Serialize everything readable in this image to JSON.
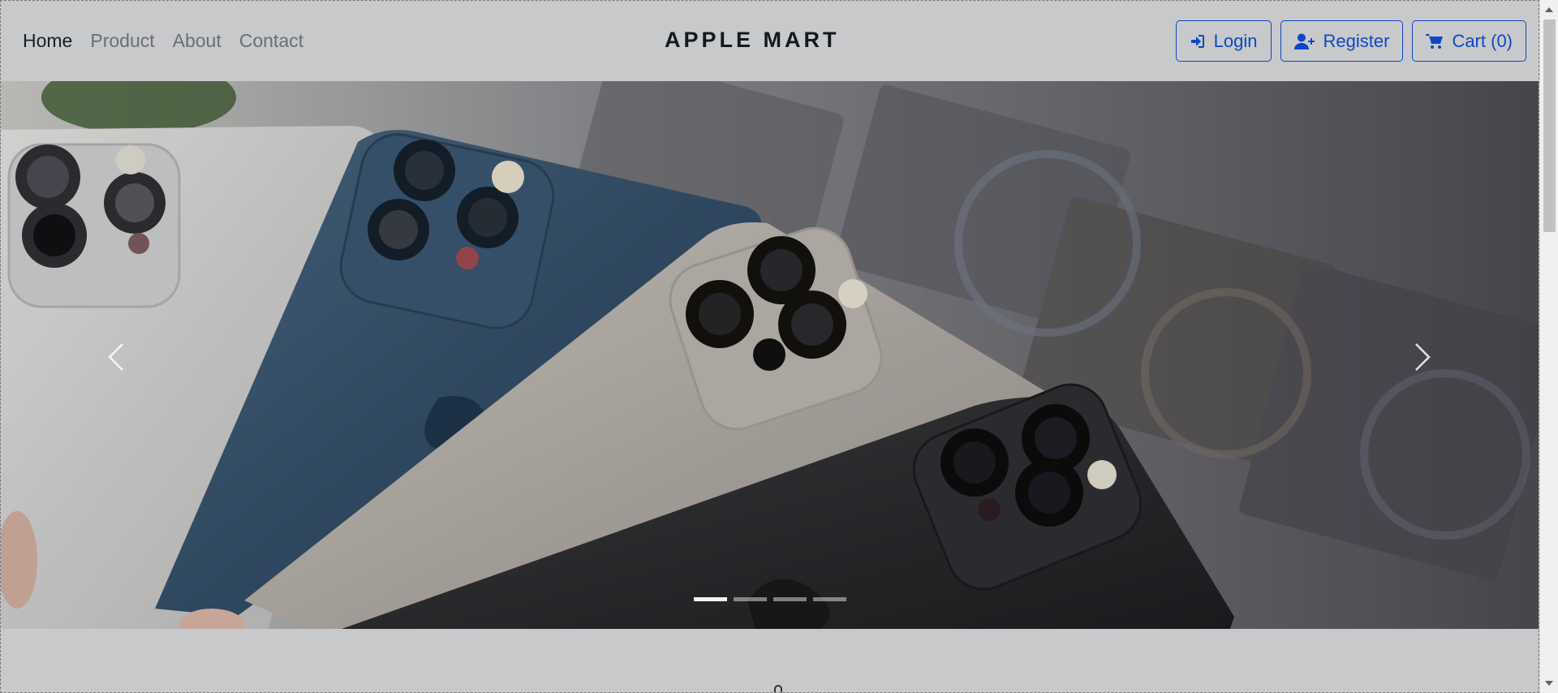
{
  "nav": {
    "links": [
      {
        "label": "Home",
        "active": true
      },
      {
        "label": "Product",
        "active": false
      },
      {
        "label": "About",
        "active": false
      },
      {
        "label": "Contact",
        "active": false
      }
    ],
    "brand": "APPLE MART",
    "buttons": {
      "login": "Login",
      "register": "Register",
      "cart": "Cart (0)"
    }
  },
  "carousel": {
    "slide_count": 4,
    "active_index": 0,
    "prev_icon": "chevron-left-icon",
    "next_icon": "chevron-right-icon"
  },
  "colors": {
    "accent": "#0d47c9",
    "navbar_bg": "#c8c9cb",
    "brand_text": "#16191c"
  }
}
